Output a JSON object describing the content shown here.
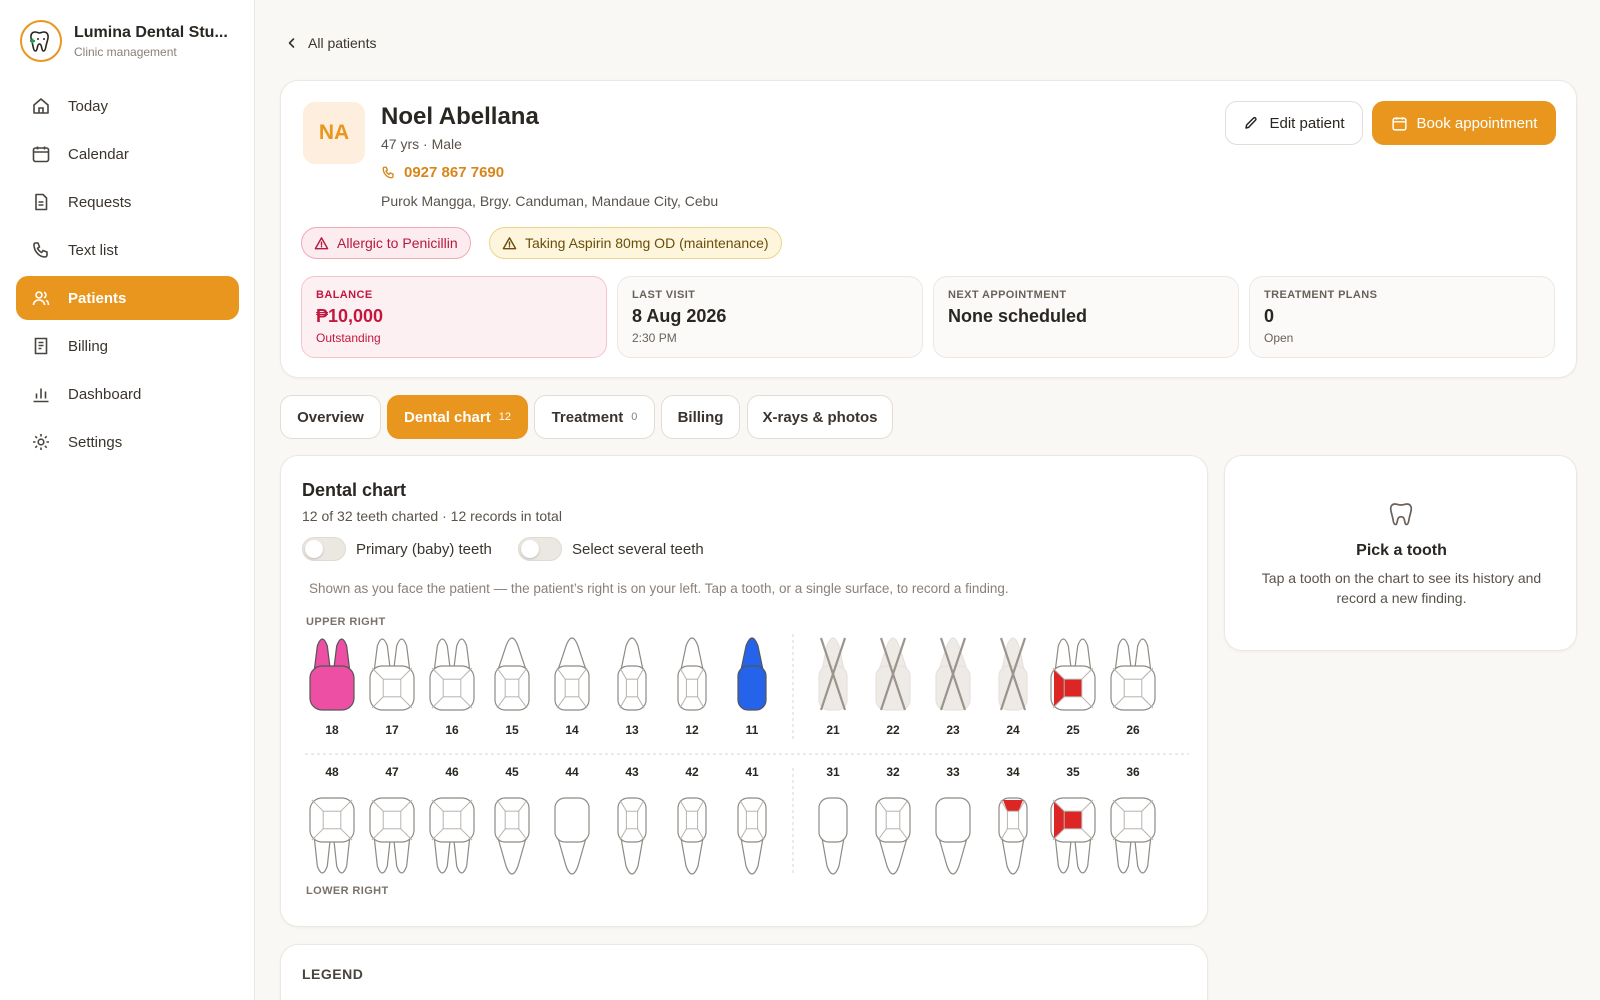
{
  "brand": {
    "name": "Lumina Dental Stu...",
    "subtitle": "Clinic management"
  },
  "nav": {
    "items": [
      {
        "label": "Today",
        "icon": "home-icon"
      },
      {
        "label": "Calendar",
        "icon": "calendar-icon"
      },
      {
        "label": "Requests",
        "icon": "document-icon"
      },
      {
        "label": "Text list",
        "icon": "phone-icon"
      },
      {
        "label": "Patients",
        "icon": "users-icon",
        "active": true
      },
      {
        "label": "Billing",
        "icon": "receipt-icon"
      },
      {
        "label": "Dashboard",
        "icon": "bar-chart-icon"
      },
      {
        "label": "Settings",
        "icon": "gear-icon"
      }
    ]
  },
  "back_link": "All patients",
  "patient": {
    "initials": "NA",
    "name": "Noel Abellana",
    "meta": "47 yrs · Male",
    "phone": "0927 867 7690",
    "address": "Purok Mangga, Brgy. Canduman, Mandaue City, Cebu",
    "alerts": [
      "Allergic to Penicillin",
      "Taking Aspirin 80mg OD (maintenance)"
    ]
  },
  "actions": {
    "edit": "Edit patient",
    "book": "Book appointment"
  },
  "stats": [
    {
      "label": "BALANCE",
      "value": "₱10,000",
      "sub": "Outstanding"
    },
    {
      "label": "LAST VISIT",
      "value": "8 Aug 2026",
      "sub": "2:30 PM"
    },
    {
      "label": "NEXT APPOINTMENT",
      "value": "None scheduled",
      "sub": ""
    },
    {
      "label": "TREATMENT PLANS",
      "value": "0",
      "sub": "Open"
    }
  ],
  "tabs": [
    {
      "label": "Overview",
      "badge": ""
    },
    {
      "label": "Dental chart",
      "badge": "12",
      "active": true
    },
    {
      "label": "Treatment",
      "badge": "0"
    },
    {
      "label": "Billing",
      "badge": ""
    },
    {
      "label": "X-rays & photos",
      "badge": ""
    }
  ],
  "chart": {
    "title": "Dental chart",
    "subtitle": "12 of 32 teeth charted · 12 records in total",
    "toggle_primary": "Primary (baby) teeth",
    "toggle_multi": "Select several teeth",
    "hint": "Shown as you face the patient — the patient’s right is on your left. Tap a tooth, or a single surface, to record a finding.",
    "upper_label": "UPPER RIGHT",
    "lower_label": "LOWER RIGHT",
    "upper_teeth": [
      {
        "num": "18",
        "status": "whole-pink"
      },
      {
        "num": "17",
        "status": ""
      },
      {
        "num": "16",
        "status": ""
      },
      {
        "num": "15",
        "status": ""
      },
      {
        "num": "14",
        "status": ""
      },
      {
        "num": "13",
        "status": ""
      },
      {
        "num": "12",
        "status": ""
      },
      {
        "num": "11",
        "status": "whole-blue"
      },
      {
        "num": "21",
        "status": "missing"
      },
      {
        "num": "22",
        "status": "missing"
      },
      {
        "num": "23",
        "status": "missing"
      },
      {
        "num": "24",
        "status": "missing"
      },
      {
        "num": "25",
        "status": "surface-red"
      },
      {
        "num": "26",
        "status": ""
      }
    ],
    "lower_teeth": [
      {
        "num": "48",
        "status": ""
      },
      {
        "num": "47",
        "status": ""
      },
      {
        "num": "46",
        "status": ""
      },
      {
        "num": "45",
        "status": ""
      },
      {
        "num": "44",
        "status": "plain"
      },
      {
        "num": "43",
        "status": ""
      },
      {
        "num": "42",
        "status": ""
      },
      {
        "num": "41",
        "status": ""
      },
      {
        "num": "31",
        "status": "plain"
      },
      {
        "num": "32",
        "status": ""
      },
      {
        "num": "33",
        "status": "plain"
      },
      {
        "num": "34",
        "status": "surface-red-top"
      },
      {
        "num": "35",
        "status": "surface-red"
      },
      {
        "num": "36",
        "status": ""
      }
    ],
    "colors": {
      "pink": "#ec4fa3",
      "blue": "#2563eb",
      "red": "#dc2626",
      "accent": "#e8961e"
    }
  },
  "legend": {
    "title": "LEGEND"
  },
  "pick": {
    "title": "Pick a tooth",
    "description": "Tap a tooth on the chart to see its history and record a new finding."
  }
}
